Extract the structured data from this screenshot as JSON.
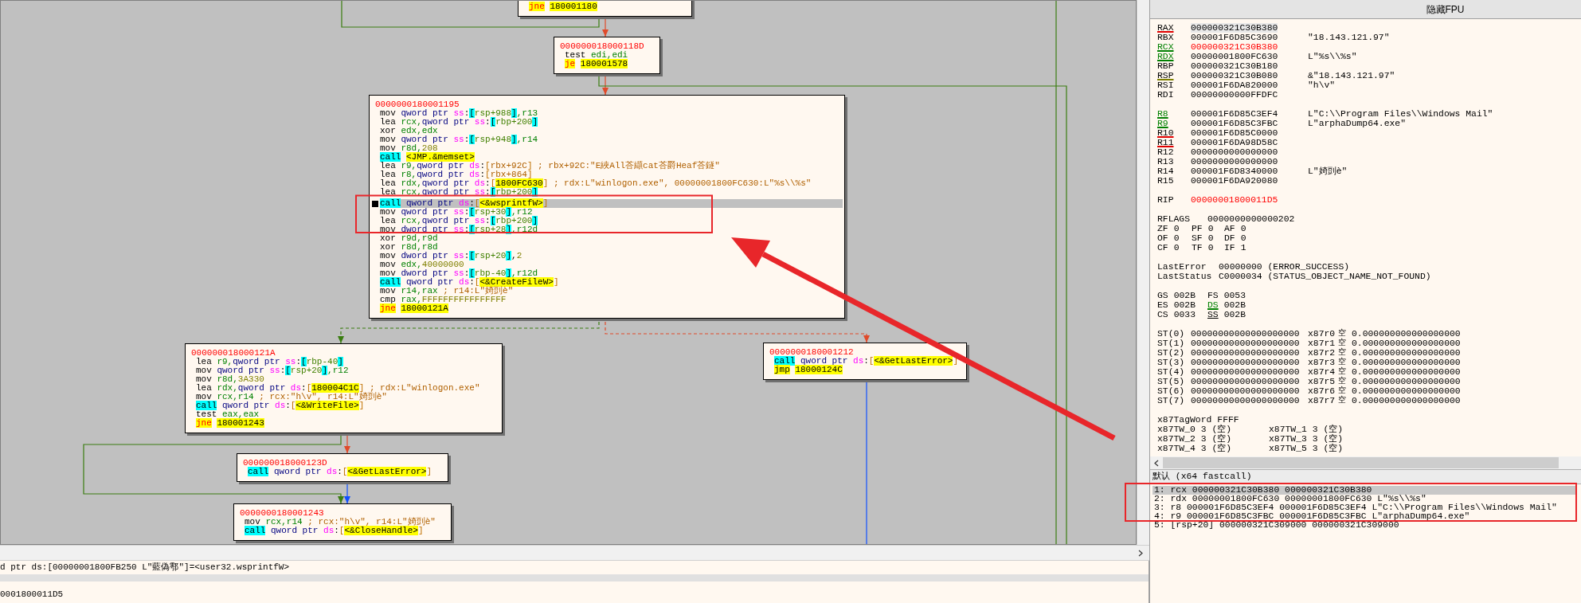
{
  "graph": {
    "blocks": [
      {
        "lines": [
          {
            "selected": false,
            "parts": [
              {
                "text": "jne",
                "kind": "jcc"
              },
              {
                "text": "180001180",
                "kind": "target"
              }
            ]
          }
        ]
      },
      {
        "address": "000000018000118D",
        "lines": [
          {
            "selected": false,
            "parts": [
              {
                "text": "test",
                "kind": "op"
              },
              {
                "text": " edi,edi",
                "kind": "reg"
              }
            ]
          },
          {
            "selected": false,
            "parts": [
              {
                "text": "je",
                "kind": "jcc"
              },
              {
                "text": "180001578",
                "kind": "target"
              }
            ]
          }
        ]
      },
      {
        "address": "0000000180001195",
        "lines": [
          {
            "selected": false,
            "parts": [
              {
                "text": "mov",
                "kind": "op"
              },
              {
                "text": " qword ptr ",
                "kind": "ptr"
              },
              {
                "text": "ss",
                "kind": "seg"
              },
              {
                "text": ":",
                "kind": "p"
              },
              {
                "text": "[",
                "kind": "bs"
              },
              {
                "text": "rsp+988",
                "kind": "mem"
              },
              {
                "text": "]",
                "kind": "bs"
              },
              {
                "text": ",r13",
                "kind": "reg"
              }
            ]
          },
          {
            "selected": false,
            "parts": [
              {
                "text": "lea",
                "kind": "op"
              },
              {
                "text": " rcx,",
                "kind": "reg"
              },
              {
                "text": "qword ptr ",
                "kind": "ptr"
              },
              {
                "text": "ss",
                "kind": "seg"
              },
              {
                "text": ":",
                "kind": "p"
              },
              {
                "text": "[",
                "kind": "bs"
              },
              {
                "text": "rbp+200",
                "kind": "mem"
              },
              {
                "text": "]",
                "kind": "bs"
              }
            ]
          },
          {
            "selected": false,
            "parts": [
              {
                "text": "xor",
                "kind": "op"
              },
              {
                "text": " edx,edx",
                "kind": "reg"
              }
            ]
          },
          {
            "selected": false,
            "parts": [
              {
                "text": "mov",
                "kind": "op"
              },
              {
                "text": " qword ptr ",
                "kind": "ptr"
              },
              {
                "text": "ss",
                "kind": "seg"
              },
              {
                "text": ":",
                "kind": "p"
              },
              {
                "text": "[",
                "kind": "bs"
              },
              {
                "text": "rsp+948",
                "kind": "mem"
              },
              {
                "text": "]",
                "kind": "bs"
              },
              {
                "text": ",r14",
                "kind": "reg"
              }
            ]
          },
          {
            "selected": false,
            "parts": [
              {
                "text": "mov",
                "kind": "op"
              },
              {
                "text": " r8d,",
                "kind": "reg"
              },
              {
                "text": "208",
                "kind": "num"
              }
            ]
          },
          {
            "selected": false,
            "parts": [
              {
                "text": "call",
                "kind": "call"
              },
              {
                "text": "<JMP.&memset>",
                "kind": "target"
              }
            ]
          },
          {
            "selected": false,
            "parts": [
              {
                "text": "lea",
                "kind": "op"
              },
              {
                "text": " r9,",
                "kind": "reg"
              },
              {
                "text": "qword ptr ",
                "kind": "ptr"
              },
              {
                "text": "ds",
                "kind": "seg"
              },
              {
                "text": ":",
                "kind": "p"
              },
              {
                "text": "[",
                "kind": "bd"
              },
              {
                "text": "rbx+92C",
                "kind": "cmt"
              },
              {
                "text": "]",
                "kind": "bd"
              },
              {
                "text": " ; rbx+92C:\"E綊All荅纈cat荅爵Heaf荅鐩\"",
                "kind": "cmt"
              }
            ]
          },
          {
            "selected": false,
            "parts": [
              {
                "text": "lea",
                "kind": "op"
              },
              {
                "text": " r8,",
                "kind": "reg"
              },
              {
                "text": "qword ptr ",
                "kind": "ptr"
              },
              {
                "text": "ds",
                "kind": "seg"
              },
              {
                "text": ":",
                "kind": "p"
              },
              {
                "text": "[",
                "kind": "bd"
              },
              {
                "text": "rbx+864",
                "kind": "cmt"
              },
              {
                "text": "]",
                "kind": "bd"
              }
            ]
          },
          {
            "selected": false,
            "parts": [
              {
                "text": "lea",
                "kind": "op"
              },
              {
                "text": " rdx,",
                "kind": "reg"
              },
              {
                "text": "qword ptr ",
                "kind": "ptr"
              },
              {
                "text": "ds",
                "kind": "seg"
              },
              {
                "text": ":",
                "kind": "p"
              },
              {
                "text": "[",
                "kind": "bd"
              },
              {
                "text": "1800FC630",
                "kind": "addr"
              },
              {
                "text": "]",
                "kind": "bd"
              },
              {
                "text": " ; rdx:L\"winlogon.exe\", 00000001800FC630:L\"%s\\\\%s\"",
                "kind": "cmt"
              }
            ]
          },
          {
            "selected": false,
            "parts": [
              {
                "text": "lea",
                "kind": "op"
              },
              {
                "text": " rcx,",
                "kind": "reg"
              },
              {
                "text": "qword ptr ",
                "kind": "ptr"
              },
              {
                "text": "ss",
                "kind": "seg"
              },
              {
                "text": ":",
                "kind": "p"
              },
              {
                "text": "[",
                "kind": "bs"
              },
              {
                "text": "rbp+200",
                "kind": "mem"
              },
              {
                "text": "]",
                "kind": "bs"
              }
            ]
          },
          {
            "selected": true,
            "parts": [
              {
                "text": "call",
                "kind": "call"
              },
              {
                "text": " qword ptr ",
                "kind": "ptr"
              },
              {
                "text": "ds",
                "kind": "seg"
              },
              {
                "text": ":",
                "kind": "p"
              },
              {
                "text": "[",
                "kind": "bd"
              },
              {
                "text": "<&wsprintfW>",
                "kind": "addr"
              },
              {
                "text": "]",
                "kind": "bd"
              }
            ]
          },
          {
            "selected": false,
            "parts": [
              {
                "text": "mov",
                "kind": "op"
              },
              {
                "text": " qword ptr ",
                "kind": "ptr"
              },
              {
                "text": "ss",
                "kind": "seg"
              },
              {
                "text": ":",
                "kind": "p"
              },
              {
                "text": "[",
                "kind": "bs"
              },
              {
                "text": "rsp+30",
                "kind": "mem"
              },
              {
                "text": "]",
                "kind": "bs"
              },
              {
                "text": ",r12",
                "kind": "reg"
              }
            ]
          },
          {
            "selected": false,
            "parts": [
              {
                "text": "lea",
                "kind": "op"
              },
              {
                "text": " rcx,",
                "kind": "reg"
              },
              {
                "text": "qword ptr ",
                "kind": "ptr"
              },
              {
                "text": "ss",
                "kind": "seg"
              },
              {
                "text": ":",
                "kind": "p"
              },
              {
                "text": "[",
                "kind": "bs"
              },
              {
                "text": "rbp+200",
                "kind": "mem"
              },
              {
                "text": "]",
                "kind": "bs"
              }
            ]
          },
          {
            "selected": false,
            "parts": [
              {
                "text": "mov",
                "kind": "op"
              },
              {
                "text": " dword ptr ",
                "kind": "ptr"
              },
              {
                "text": "ss",
                "kind": "seg"
              },
              {
                "text": ":",
                "kind": "p"
              },
              {
                "text": "[",
                "kind": "bs"
              },
              {
                "text": "rsp+28",
                "kind": "mem"
              },
              {
                "text": "]",
                "kind": "bs"
              },
              {
                "text": ",r12d",
                "kind": "reg"
              }
            ]
          },
          {
            "selected": false,
            "parts": [
              {
                "text": "xor",
                "kind": "op"
              },
              {
                "text": " r9d,r9d",
                "kind": "reg"
              }
            ]
          },
          {
            "selected": false,
            "parts": [
              {
                "text": "xor",
                "kind": "op"
              },
              {
                "text": " r8d,r8d",
                "kind": "reg"
              }
            ]
          },
          {
            "selected": false,
            "parts": [
              {
                "text": "mov",
                "kind": "op"
              },
              {
                "text": " dword ptr ",
                "kind": "ptr"
              },
              {
                "text": "ss",
                "kind": "seg"
              },
              {
                "text": ":",
                "kind": "p"
              },
              {
                "text": "[",
                "kind": "bs"
              },
              {
                "text": "rsp+20",
                "kind": "mem"
              },
              {
                "text": "]",
                "kind": "bs"
              },
              {
                "text": ",",
                "kind": "p"
              },
              {
                "text": "2",
                "kind": "num"
              }
            ]
          },
          {
            "selected": false,
            "parts": [
              {
                "text": "mov",
                "kind": "op"
              },
              {
                "text": " edx,",
                "kind": "reg"
              },
              {
                "text": "40000000",
                "kind": "num"
              }
            ]
          },
          {
            "selected": false,
            "parts": [
              {
                "text": "mov",
                "kind": "op"
              },
              {
                "text": " dword ptr ",
                "kind": "ptr"
              },
              {
                "text": "ss",
                "kind": "seg"
              },
              {
                "text": ":",
                "kind": "p"
              },
              {
                "text": "[",
                "kind": "bs"
              },
              {
                "text": "rbp-40",
                "kind": "mem"
              },
              {
                "text": "]",
                "kind": "bs"
              },
              {
                "text": ",r12d",
                "kind": "reg"
              }
            ]
          },
          {
            "selected": false,
            "parts": [
              {
                "text": "call",
                "kind": "call"
              },
              {
                "text": " qword ptr ",
                "kind": "ptr"
              },
              {
                "text": "ds",
                "kind": "seg"
              },
              {
                "text": ":",
                "kind": "p"
              },
              {
                "text": "[",
                "kind": "bd"
              },
              {
                "text": "<&CreateFileW>",
                "kind": "addr"
              },
              {
                "text": "]",
                "kind": "bd"
              }
            ]
          },
          {
            "selected": false,
            "parts": [
              {
                "text": "mov",
                "kind": "op"
              },
              {
                "text": " r14,rax",
                "kind": "reg"
              },
              {
                "text": " ; r14:L\"婍剅è\"",
                "kind": "cmt"
              }
            ]
          },
          {
            "selected": false,
            "parts": [
              {
                "text": "cmp",
                "kind": "op"
              },
              {
                "text": " rax,",
                "kind": "reg"
              },
              {
                "text": "FFFFFFFFFFFFFFFF",
                "kind": "num"
              }
            ]
          },
          {
            "selected": false,
            "parts": [
              {
                "text": "jne",
                "kind": "jcc"
              },
              {
                "text": "18000121A",
                "kind": "target"
              }
            ]
          }
        ]
      },
      {
        "address": "000000018000121A",
        "lines": [
          {
            "selected": false,
            "parts": [
              {
                "text": "lea",
                "kind": "op"
              },
              {
                "text": " r9,",
                "kind": "reg"
              },
              {
                "text": "qword ptr ",
                "kind": "ptr"
              },
              {
                "text": "ss",
                "kind": "seg"
              },
              {
                "text": ":",
                "kind": "p"
              },
              {
                "text": "[",
                "kind": "bs"
              },
              {
                "text": "rbp-40",
                "kind": "mem"
              },
              {
                "text": "]",
                "kind": "bs"
              }
            ]
          },
          {
            "selected": false,
            "parts": [
              {
                "text": "mov",
                "kind": "op"
              },
              {
                "text": " qword ptr ",
                "kind": "ptr"
              },
              {
                "text": "ss",
                "kind": "seg"
              },
              {
                "text": ":",
                "kind": "p"
              },
              {
                "text": "[",
                "kind": "bs"
              },
              {
                "text": "rsp+20",
                "kind": "mem"
              },
              {
                "text": "]",
                "kind": "bs"
              },
              {
                "text": ",r12",
                "kind": "reg"
              }
            ]
          },
          {
            "selected": false,
            "parts": [
              {
                "text": "mov",
                "kind": "op"
              },
              {
                "text": " r8d,",
                "kind": "reg"
              },
              {
                "text": "3A330",
                "kind": "num"
              }
            ]
          },
          {
            "selected": false,
            "parts": [
              {
                "text": "lea",
                "kind": "op"
              },
              {
                "text": " rdx,",
                "kind": "reg"
              },
              {
                "text": "qword ptr ",
                "kind": "ptr"
              },
              {
                "text": "ds",
                "kind": "seg"
              },
              {
                "text": ":",
                "kind": "p"
              },
              {
                "text": "[",
                "kind": "bd"
              },
              {
                "text": "180004C1C",
                "kind": "addr"
              },
              {
                "text": "]",
                "kind": "bd"
              },
              {
                "text": " ; rdx:L\"winlogon.exe\"",
                "kind": "cmt"
              }
            ]
          },
          {
            "selected": false,
            "parts": [
              {
                "text": "mov",
                "kind": "op"
              },
              {
                "text": " rcx,r14",
                "kind": "reg"
              },
              {
                "text": " ; rcx:\"h\\v\", r14:L\"婍剅è\"",
                "kind": "cmt"
              }
            ]
          },
          {
            "selected": false,
            "parts": [
              {
                "text": "call",
                "kind": "call"
              },
              {
                "text": " qword ptr ",
                "kind": "ptr"
              },
              {
                "text": "ds",
                "kind": "seg"
              },
              {
                "text": ":",
                "kind": "p"
              },
              {
                "text": "[",
                "kind": "bd"
              },
              {
                "text": "<&WriteFile>",
                "kind": "addr"
              },
              {
                "text": "]",
                "kind": "bd"
              }
            ]
          },
          {
            "selected": false,
            "parts": [
              {
                "text": "test",
                "kind": "op"
              },
              {
                "text": " eax,eax",
                "kind": "reg"
              }
            ]
          },
          {
            "selected": false,
            "parts": [
              {
                "text": "jne",
                "kind": "jcc"
              },
              {
                "text": "180001243",
                "kind": "target"
              }
            ]
          }
        ]
      },
      {
        "address": "0000000180001212",
        "lines": [
          {
            "selected": false,
            "parts": [
              {
                "text": "call",
                "kind": "call"
              },
              {
                "text": " qword ptr ",
                "kind": "ptr"
              },
              {
                "text": "ds",
                "kind": "seg"
              },
              {
                "text": ":",
                "kind": "p"
              },
              {
                "text": "[",
                "kind": "bd"
              },
              {
                "text": "<&GetLastError>",
                "kind": "addr"
              },
              {
                "text": "]",
                "kind": "bd"
              }
            ]
          },
          {
            "selected": false,
            "parts": [
              {
                "text": "jmp",
                "kind": "jmp"
              },
              {
                "text": "18000124C",
                "kind": "target"
              }
            ]
          }
        ]
      },
      {
        "address": "000000018000123D",
        "lines": [
          {
            "selected": false,
            "parts": [
              {
                "text": "call",
                "kind": "call"
              },
              {
                "text": " qword ptr ",
                "kind": "ptr"
              },
              {
                "text": "ds",
                "kind": "seg"
              },
              {
                "text": ":",
                "kind": "p"
              },
              {
                "text": "[",
                "kind": "bd"
              },
              {
                "text": "<&GetLastError>",
                "kind": "addr"
              },
              {
                "text": "]",
                "kind": "bd"
              }
            ]
          }
        ]
      },
      {
        "address": "0000000180001243",
        "lines": [
          {
            "selected": false,
            "parts": [
              {
                "text": "mov",
                "kind": "op"
              },
              {
                "text": " rcx,r14",
                "kind": "reg"
              },
              {
                "text": " ; rcx:\"h\\v\", r14:L\"婍剅è\"",
                "kind": "cmt"
              }
            ]
          },
          {
            "selected": false,
            "parts": [
              {
                "text": "call",
                "kind": "call"
              },
              {
                "text": " qword ptr ",
                "kind": "ptr"
              },
              {
                "text": "ds",
                "kind": "seg"
              },
              {
                "text": ":",
                "kind": "p"
              },
              {
                "text": "[",
                "kind": "bd"
              },
              {
                "text": "<&CloseHandle>",
                "kind": "addr"
              },
              {
                "text": "]",
                "kind": "bd"
              }
            ]
          }
        ]
      }
    ]
  },
  "info_panel": {
    "detail": "d ptr ds:[00000001800FB250 L\"藍偽鄠\"]=<user32.wsprintfW>",
    "address": "0001800011D5"
  },
  "registers_panel": {
    "header": "隐藏FPU",
    "register_groups": [
      [
        {
          "name": "RAX",
          "value": "000000321C30B380",
          "kind": "write",
          "changed": false,
          "selected": true
        },
        {
          "name": "RBX",
          "value": "000001F6D85C3690",
          "comment": "\"18.143.121.97\"",
          "kind": "none",
          "changed": false,
          "selected": false
        },
        {
          "name": "RCX",
          "value": "000000321C30B380",
          "kind": "read",
          "changed": true,
          "selected": false
        },
        {
          "name": "RDX",
          "value": "00000001800FC630",
          "comment": "L\"%s\\\\%s\"",
          "kind": "read",
          "changed": false,
          "selected": false
        },
        {
          "name": "RBP",
          "value": "000000321C30B180",
          "kind": "none",
          "changed": false,
          "selected": false
        },
        {
          "name": "RSP",
          "value": "000000321C30B080",
          "comment": "&\"18.143.121.97\"",
          "kind": "stack",
          "changed": false,
          "selected": false
        },
        {
          "name": "RSI",
          "value": "000001F6DA820000",
          "comment": "\"h\\v\"",
          "kind": "none",
          "changed": false,
          "selected": false
        },
        {
          "name": "RDI",
          "value": "00000000000FFDFC",
          "kind": "none",
          "changed": false,
          "selected": false
        }
      ],
      [
        {
          "name": "R8",
          "value": "000001F6D85C3EF4",
          "comment": "L\"C:\\\\Program Files\\\\Windows Mail\"",
          "kind": "read",
          "changed": false,
          "selected": false
        },
        {
          "name": "R9",
          "value": "000001F6D85C3FBC",
          "comment": "L\"arphaDump64.exe\"",
          "kind": "read",
          "changed": false,
          "selected": false
        },
        {
          "name": "R10",
          "value": "000001F6D85C0000",
          "kind": "write",
          "changed": false,
          "selected": false
        },
        {
          "name": "R11",
          "value": "000001F6DA98D58C",
          "kind": "write",
          "changed": false,
          "selected": false
        },
        {
          "name": "R12",
          "value": "0000000000000000",
          "kind": "none",
          "changed": false,
          "selected": false
        },
        {
          "name": "R13",
          "value": "0000000000000000",
          "kind": "none",
          "changed": false,
          "selected": false
        },
        {
          "name": "R14",
          "value": "000001F6D8340000",
          "comment": "L\"婍剅è\"",
          "kind": "none",
          "changed": false,
          "selected": false
        },
        {
          "name": "R15",
          "value": "000001F6DA920080",
          "kind": "none",
          "changed": false,
          "selected": false
        }
      ],
      [
        {
          "name": "RIP",
          "value": "00000001800011D5",
          "kind": "none",
          "changed": true,
          "selected": false
        }
      ]
    ],
    "rflags": {
      "name": "RFLAGS",
      "value": "0000000000000202"
    },
    "flag_rows": [
      [
        {
          "name": "ZF",
          "value": "0"
        },
        {
          "name": "PF",
          "value": "0"
        },
        {
          "name": "AF",
          "value": "0"
        }
      ],
      [
        {
          "name": "OF",
          "value": "0"
        },
        {
          "name": "SF",
          "value": "0"
        },
        {
          "name": "DF",
          "value": "0"
        }
      ],
      [
        {
          "name": "CF",
          "value": "0"
        },
        {
          "name": "TF",
          "value": "0"
        },
        {
          "name": "IF",
          "value": "1"
        }
      ]
    ],
    "errors": [
      {
        "name": "LastError",
        "value": "00000000 (ERROR_SUCCESS)"
      },
      {
        "name": "LastStatus",
        "value": "C0000034 (STATUS_OBJECT_NAME_NOT_FOUND)"
      }
    ],
    "segment_rows": [
      [
        {
          "name": "GS",
          "value": "002B",
          "kind": "none"
        },
        {
          "name": "FS",
          "value": "0053",
          "kind": "none"
        }
      ],
      [
        {
          "name": "ES",
          "value": "002B",
          "kind": "none"
        },
        {
          "name": "DS",
          "value": "002B",
          "kind": "read"
        }
      ],
      [
        {
          "name": "CS",
          "value": "0033",
          "kind": "none"
        },
        {
          "name": "SS",
          "value": "002B",
          "kind": "segment"
        }
      ]
    ],
    "fpu": [
      {
        "name": "ST(0)",
        "value": "00000000000000000000",
        "tag_register": "x87r0",
        "tag": "空",
        "number": "0.000000000000000000"
      },
      {
        "name": "ST(1)",
        "value": "00000000000000000000",
        "tag_register": "x87r1",
        "tag": "空",
        "number": "0.000000000000000000"
      },
      {
        "name": "ST(2)",
        "value": "00000000000000000000",
        "tag_register": "x87r2",
        "tag": "空",
        "number": "0.000000000000000000"
      },
      {
        "name": "ST(3)",
        "value": "00000000000000000000",
        "tag_register": "x87r3",
        "tag": "空",
        "number": "0.000000000000000000"
      },
      {
        "name": "ST(4)",
        "value": "00000000000000000000",
        "tag_register": "x87r4",
        "tag": "空",
        "number": "0.000000000000000000"
      },
      {
        "name": "ST(5)",
        "value": "00000000000000000000",
        "tag_register": "x87r5",
        "tag": "空",
        "number": "0.000000000000000000"
      },
      {
        "name": "ST(6)",
        "value": "00000000000000000000",
        "tag_register": "x87r6",
        "tag": "空",
        "number": "0.000000000000000000"
      },
      {
        "name": "ST(7)",
        "value": "00000000000000000000",
        "tag_register": "x87r7",
        "tag": "空",
        "number": "0.000000000000000000"
      }
    ],
    "tag_word": {
      "name": "x87TagWord",
      "value": "FFFF"
    },
    "tag_word_rows": [
      [
        {
          "name": "x87TW_0",
          "value": "3 (空)"
        },
        {
          "name": "x87TW_1",
          "value": "3 (空)"
        }
      ],
      [
        {
          "name": "x87TW_2",
          "value": "3 (空)"
        },
        {
          "name": "x87TW_3",
          "value": "3 (空)"
        }
      ],
      [
        {
          "name": "x87TW_4",
          "value": "3 (空)"
        },
        {
          "name": "x87TW_5",
          "value": "3 (空)"
        }
      ]
    ]
  },
  "call_arguments": {
    "title": "默认 (x64 fastcall)",
    "args": [
      {
        "text": "1: rcx 000000321C30B380 000000321C30B380",
        "selected": true
      },
      {
        "text": "2: rdx 00000001800FC630 00000001800FC630 L\"%s\\\\%s\"",
        "selected": false
      },
      {
        "text": "3: r8 000001F6D85C3EF4 000001F6D85C3EF4 L\"C:\\\\Program Files\\\\Windows Mail\"",
        "selected": false
      },
      {
        "text": "4: r9 000001F6D85C3FBC 000001F6D85C3FBC L\"arphaDump64.exe\"",
        "selected": false
      },
      {
        "text": "5: [rsp+20] 000000321C309000 000000321C309000",
        "selected": false
      }
    ]
  }
}
